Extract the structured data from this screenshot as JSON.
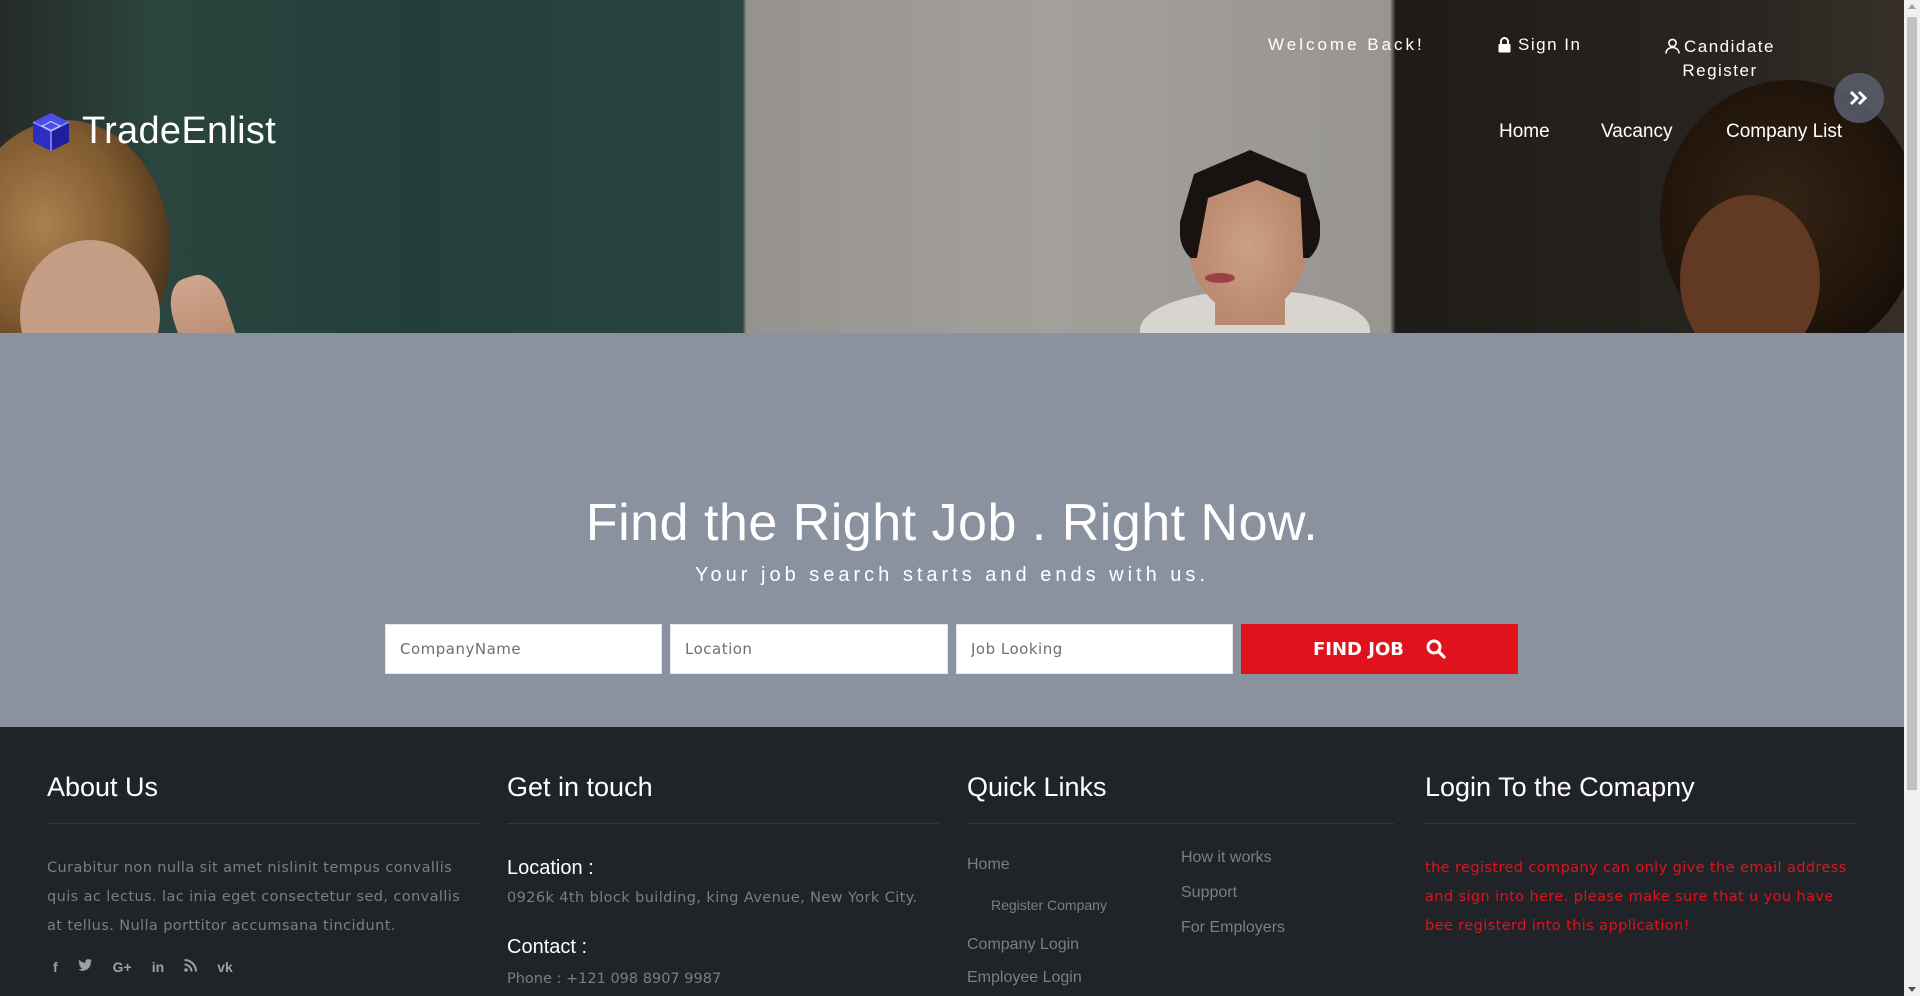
{
  "header": {
    "brand_name": "TradeEnlist",
    "welcome": "Welcome Back!",
    "sign_in": "Sign In",
    "candidate_register_line1": "Candidate",
    "candidate_register_line2": "Register",
    "nav": {
      "home": "Home",
      "vacancy": "Vacancy",
      "company_list": "Company List"
    },
    "icons": {
      "lock": "lock-icon",
      "user": "user-icon",
      "collapse": "double-chevron-right-icon",
      "logo": "cube-logo-icon"
    }
  },
  "search": {
    "title": "Find the Right Job . Right Now.",
    "subtitle": "Your job search starts and ends with us.",
    "company_placeholder": "CompanyName",
    "location_placeholder": "Location",
    "job_placeholder": "Job Looking",
    "button_label": "FIND JOB",
    "button_icon": "search-icon"
  },
  "footer": {
    "about": {
      "title": "About Us",
      "text": "Curabitur non nulla sit amet nislinit tempus convallis quis ac lectus. lac inia eget consectetur sed, convallis at tellus. Nulla porttitor accumsana tincidunt.",
      "socials": [
        "f",
        "t",
        "G+",
        "in",
        "rss",
        "vk"
      ]
    },
    "contact": {
      "title": "Get in touch",
      "location_label": "Location :",
      "location_value": "0926k 4th block building, king Avenue, New York City.",
      "contact_label": "Contact :",
      "phone": "Phone : +121 098 8907 9987"
    },
    "quick_links": {
      "title": "Quick Links",
      "items": [
        "Home",
        "Register Company",
        "Company Login",
        "Employee Login",
        "How it works",
        "Support",
        "For Employers"
      ]
    },
    "login": {
      "title": "Login To the Comapny",
      "text": "the registred company can only give the email address and sign into here. please make sure that u you have bee registerd into this application!"
    }
  },
  "colors": {
    "accent_red": "#e0131d",
    "search_bg": "#8b929f",
    "footer_bg": "#202327"
  }
}
